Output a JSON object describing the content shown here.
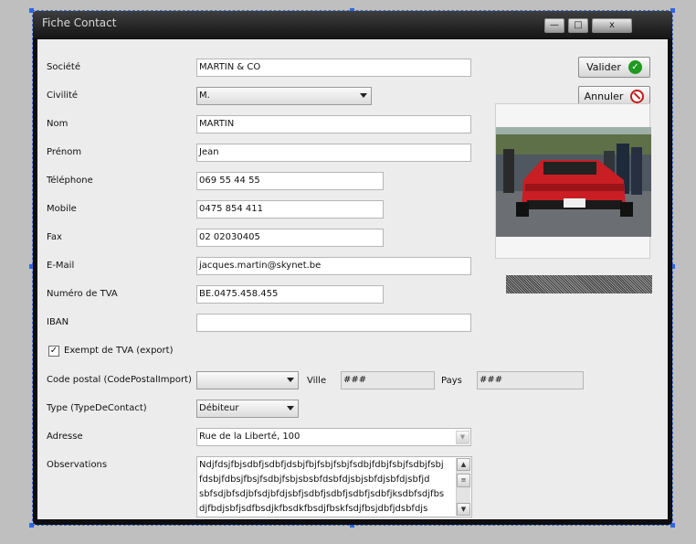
{
  "window": {
    "title": "Fiche Contact",
    "controls": {
      "minimize": "—",
      "maximize": "□",
      "close": "x"
    }
  },
  "actions": {
    "validate_label": "Valider",
    "cancel_label": "Annuler"
  },
  "form": {
    "societe": {
      "label": "Société",
      "value": "MARTIN & CO"
    },
    "civilite": {
      "label": "Civilité",
      "value": "M."
    },
    "nom": {
      "label": "Nom",
      "value": "MARTIN"
    },
    "prenom": {
      "label": "Prénom",
      "value": "Jean"
    },
    "telephone": {
      "label": "Téléphone",
      "value": "069 55 44 55"
    },
    "mobile": {
      "label": "Mobile",
      "value": "0475 854 411"
    },
    "fax": {
      "label": "Fax",
      "value": "02 02030405"
    },
    "email": {
      "label": "E-Mail",
      "value": "jacques.martin@skynet.be"
    },
    "tva": {
      "label": "Numéro de TVA",
      "value": "BE.0475.458.455"
    },
    "iban": {
      "label": "IBAN",
      "value": ""
    },
    "exempt": {
      "label": "Exempt de TVA (export)",
      "checked": true
    },
    "code_postal": {
      "label": "Code postal (CodePostalImport)",
      "value": ""
    },
    "ville": {
      "label": "Ville",
      "value": "###"
    },
    "pays": {
      "label": "Pays",
      "value": "###"
    },
    "type": {
      "label": "Type (TypeDeContact)",
      "value": "Débiteur"
    },
    "adresse": {
      "label": "Adresse",
      "value": "Rue de la Liberté, 100"
    },
    "observations": {
      "label": "Observations",
      "lines": [
        "Ndjfdsjfbjsdbfjsdbfjdsbjfbjfsbjfsbjfsdbjfdbjfsbjfsdbjfsbj",
        "fdsbjfdbsjfbsjfsdbjfsbjsbsbfdsbfdjsbjsbfdjsbfdjsbfjd",
        "sbfsdjbfsdjbfsdjbfdjsbfjsdbfjsdbfjsdbfjsdbfjksdbfsdjfbs",
        "djfbdjsbfjsdfbsdjkfbsdkfbsdjfbskfsdjfbsjdbfjdsbfdjs"
      ]
    }
  },
  "icons": {
    "validate": "check-circle-icon",
    "cancel": "no-entry-icon"
  },
  "colors": {
    "window_chrome": "#151515",
    "client_bg": "#ececec",
    "ok_green": "#1f9a1f",
    "cancel_red": "#c81818"
  }
}
